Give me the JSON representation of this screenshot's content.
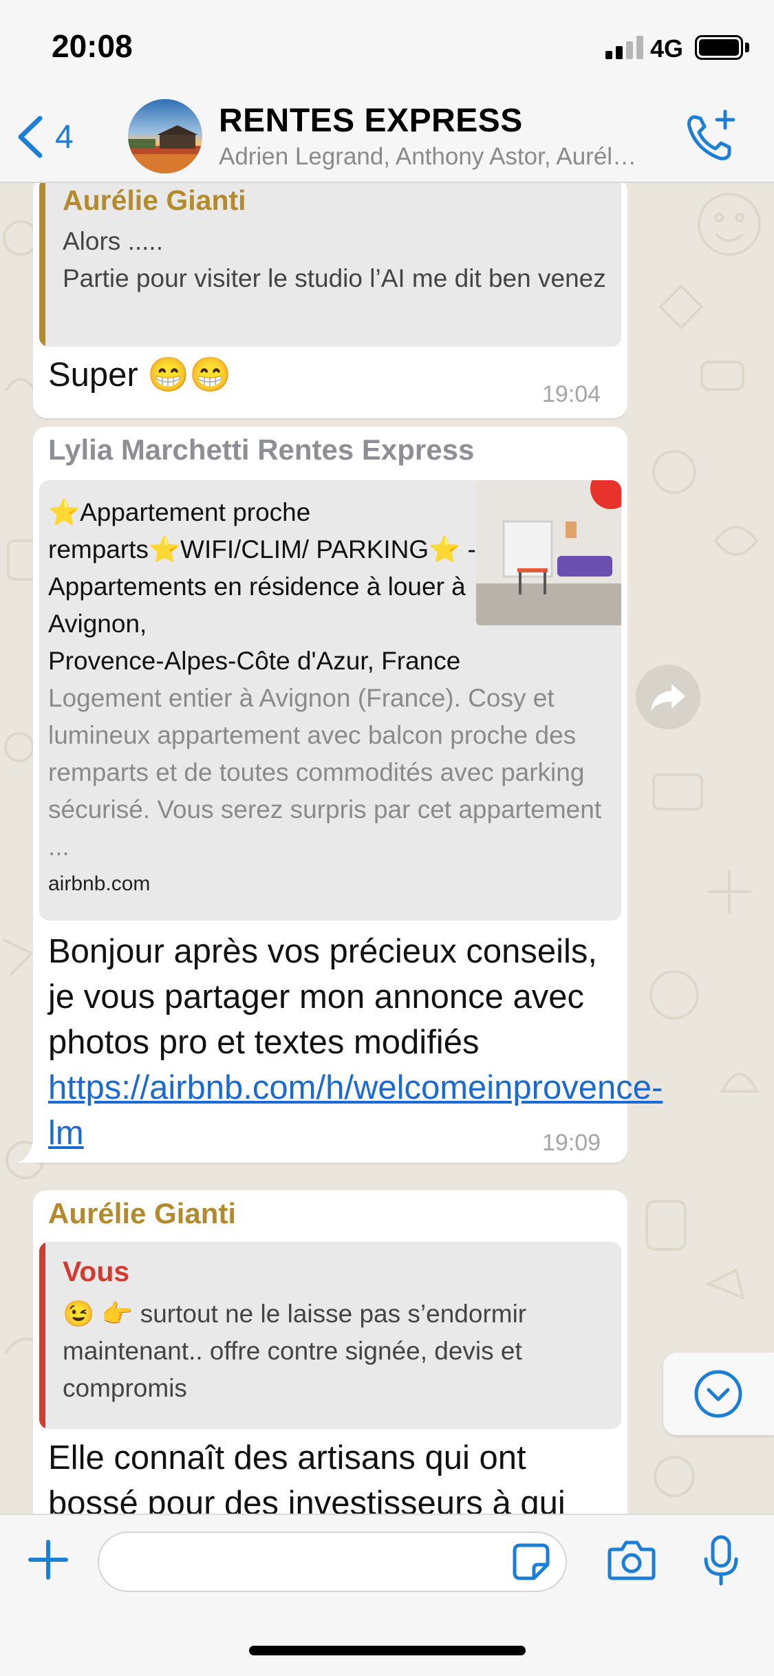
{
  "colors": {
    "ios_blue": "#1d7ed6",
    "sender_gold": "#b38a2c",
    "sender_grey": "#8d8f95",
    "quote_red": "#d23b2f",
    "link_blue": "#1b6ad2",
    "chat_background": "#ebe6dd"
  },
  "status_bar": {
    "time": "20:08",
    "network": "4G"
  },
  "header": {
    "back_count": "4",
    "title": "RENTES EXPRESS",
    "subtitle": "Adrien Legrand, Anthony Astor, Aurél…",
    "icons": {
      "back": "chevron-left-icon",
      "call": "phone-plus-icon"
    }
  },
  "messages": [
    {
      "quote": {
        "name": "Aurélie Gianti",
        "line1": "Alors .....",
        "line2": "Partie pour visiter le studio l’AI me dit ben venez avec moi j’ai un autre appart dans l..."
      },
      "text": "Super 😁😁",
      "time": "19:04"
    },
    {
      "sender": "Lylia Marchetti Rentes Express",
      "link_preview": {
        "title": "⭐Appartement proche remparts⭐WIFI/CLIM/ PARKING⭐ - Appartements en résidence à louer à Avignon,",
        "title_end": "Provence-Alpes-Côte d'Azur, France",
        "description": "Logement entier à Avignon (France). Cosy et lumineux appartement avec balcon proche des remparts et de toutes commodités avec parking sécurisé. Vous serez surpris par cet appartement ...",
        "domain": "airbnb.com"
      },
      "text": "Bonjour après vos précieux conseils, je vous partager mon annonce avec photos pro et textes modifiés ",
      "link": "https://airbnb.com/h/welcomeinprovence-lm",
      "time": "19:09"
    },
    {
      "sender": "Aurélie Gianti",
      "quote": {
        "name": "Vous",
        "text": "😉 👉 surtout ne le laisse pas s’endormir maintenant.. offre contre signée, devis et compromis"
      },
      "text": "Elle connaît des artisans qui ont bossé pour des investisseurs à qui"
    }
  ],
  "input": {
    "value": "",
    "placeholder": ""
  },
  "toolbar_icons": [
    "plus-icon",
    "sticker-icon",
    "camera-icon",
    "microphone-icon"
  ]
}
